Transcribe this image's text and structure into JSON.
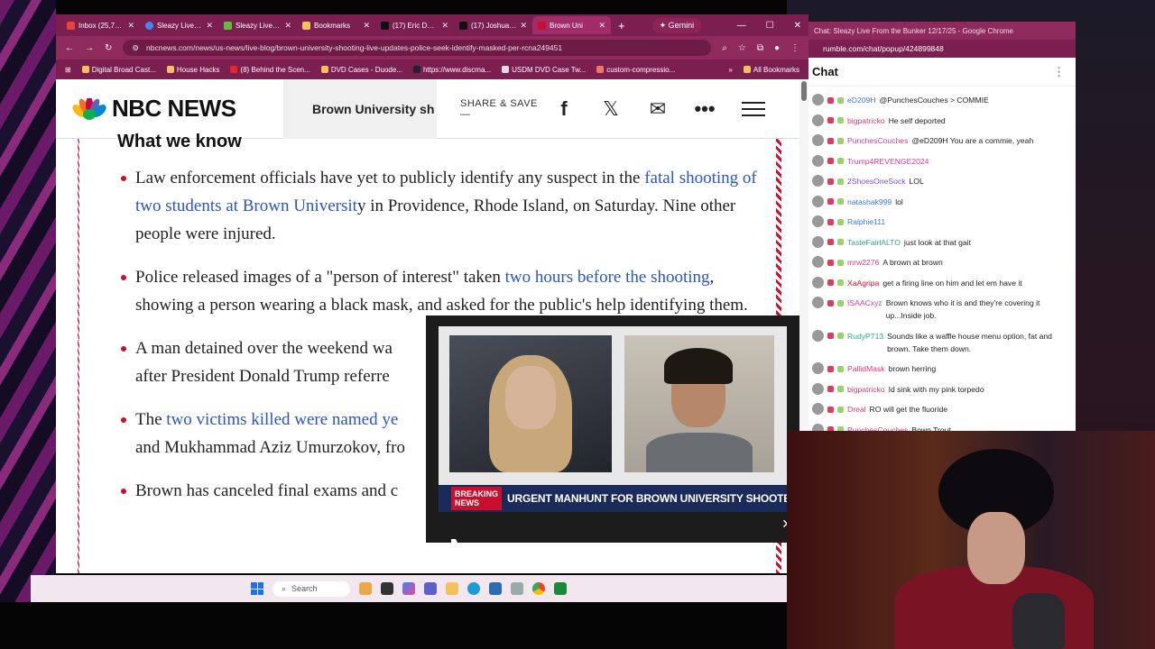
{
  "browser": {
    "tabs": [
      {
        "label": "Inbox (25,722)",
        "color": "#ea4335"
      },
      {
        "label": "Sleazy Live fro",
        "color": "#4285f4"
      },
      {
        "label": "Sleazy Live Fro",
        "color": "#5fbf3a"
      },
      {
        "label": "Bookmarks",
        "color": "#f4c15a"
      },
      {
        "label": "(17) Eric Daug",
        "color": "#111111"
      },
      {
        "label": "(17) Joshua Ha",
        "color": "#111111"
      },
      {
        "label": "Brown Uni",
        "color": "#c8102e"
      }
    ],
    "gemini_label": "Gemini",
    "url": "nbcnews.com/news/us-news/live-blog/brown-university-shooting-live-updates-police-seek-identify-masked-per-rcna249451",
    "bookmarks": [
      "Digital Broad Cast...",
      "House Hacks",
      "(8) Behind the Scen...",
      "DVD Cases - Duode...",
      "https://www.discma...",
      "USDM DVD Case Tw...",
      "custom-compressio..."
    ],
    "all_bookmarks": "All Bookmarks"
  },
  "nbc": {
    "logo_text": "NBC NEWS",
    "headline": "Brown University sh",
    "share_label": "SHARE & SAVE —",
    "section_title": "What we know",
    "bullets": [
      {
        "pre": "Law enforcement officials have yet to publicly identify any suspect in the ",
        "link": "fatal shooting of two students at Brown Universit",
        "post": "y in Providence, Rhode Island, on Saturday. Nine other people were injured."
      },
      {
        "pre": "Police released images of a \"person of interest\" taken ",
        "link": "two hours before the shooting",
        "post": ", showing a person wearing a black mask, and asked for the public's help identifying them."
      },
      {
        "pre": "A man detained over the weekend wa",
        "link": "",
        "post": " after President Donald Trump referre"
      },
      {
        "pre": "The ",
        "link": "two victims killed were named ye",
        "post": " and Mukhammad Aziz Umurzokov, fro"
      },
      {
        "pre": "Brown has canceled final exams and c",
        "link": "",
        "post": ""
      }
    ]
  },
  "video": {
    "badge": "BREAKING NEWS",
    "ticker": "URGENT MANHUNT FOR BROWN UNIVERSITY SHOOTER"
  },
  "taskbar": {
    "search_placeholder": "Search"
  },
  "chat": {
    "window_title": "Chat: Sleazy Live From the Bunker 12/17/25 - Google Chrome",
    "url": "rumble.com/chat/popup/424899848",
    "title": "Chat",
    "messages": [
      {
        "user": "eD209H",
        "text": "@PunchesCouches > COMMIE",
        "color": "#3a7bd5"
      },
      {
        "user": "bigpatricko",
        "text": "He self deported",
        "color": "#d63c7a"
      },
      {
        "user": "PunchesCouches",
        "text": "@eD209H You are a commie, yeah",
        "color": "#d63c9a"
      },
      {
        "user": "Trump4REVENGE2024",
        "text": "",
        "color": "#d63c9a"
      },
      {
        "user": "2ShoesOneSock",
        "text": "LOL",
        "color": "#7a4fd6"
      },
      {
        "user": "natashak999",
        "text": "lol",
        "color": "#3a7bd5"
      },
      {
        "user": "Ralphie111",
        "text": "",
        "color": "#3a7bd5"
      },
      {
        "user": "TasteFairlALTO",
        "text": "just look at that gait",
        "color": "#2aa88a"
      },
      {
        "user": "mrw2276",
        "text": "A brown at brown",
        "color": "#d63c7a"
      },
      {
        "user": "XaAgripa",
        "text": "get a firing line on him and let em have it",
        "color": "#c8102e"
      },
      {
        "user": "ISAACxyz",
        "text": "Brown knows who it is and they're covering it up...Inside job.",
        "color": "#d63c9a"
      },
      {
        "user": "RudyP713",
        "text": "Sounds like a waffle house menu option, fat and brown. Take them down.",
        "color": "#2aa88a"
      },
      {
        "user": "PallidMask",
        "text": "brown herring",
        "color": "#d63c7a"
      },
      {
        "user": "bigpatricko",
        "text": "Id sink with my pink torpedo",
        "color": "#d63c7a"
      },
      {
        "user": "Dreal",
        "text": "RO will get the fluoride",
        "color": "#d63c7a"
      },
      {
        "user": "PunchesCouches",
        "text": "Bown Trout",
        "color": "#d63c9a"
      }
    ]
  }
}
